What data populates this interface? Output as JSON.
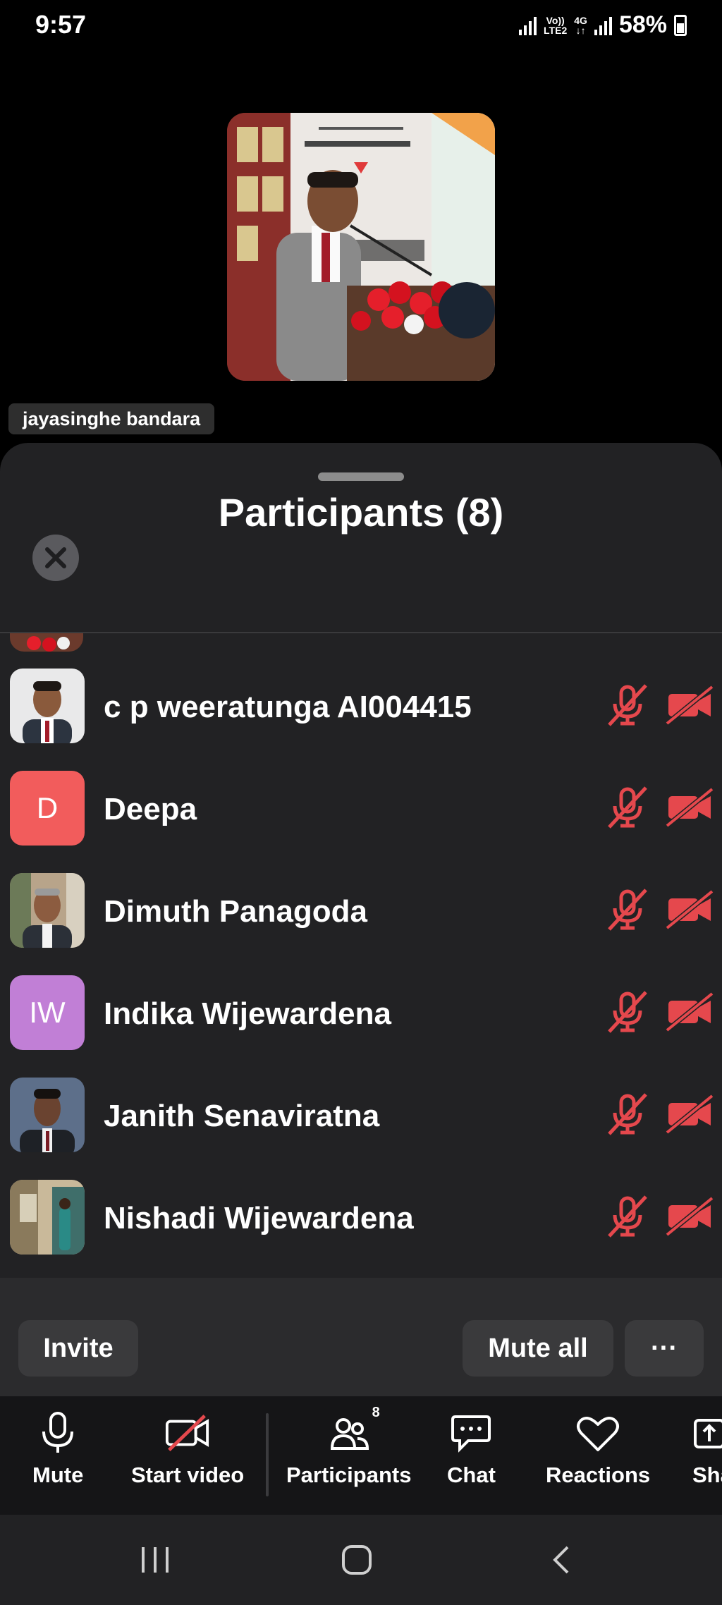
{
  "status_bar": {
    "time": "9:57",
    "network_top": "Vo))",
    "network_bottom": "LTE2",
    "data_top": "4G",
    "data_bottom": "↓↑",
    "battery": "58%"
  },
  "video": {
    "speaker_name": "jayasinghe bandara"
  },
  "participants_panel": {
    "title": "Participants (8)",
    "participants": [
      {
        "name": "c p weeratunga AI004415",
        "initials": "",
        "avatar_type": "photo",
        "mic": "muted",
        "video": "off"
      },
      {
        "name": "Deepa",
        "initials": "D",
        "avatar_type": "initials",
        "avatar_color": "#f25c5c",
        "mic": "muted",
        "video": "off"
      },
      {
        "name": "Dimuth Panagoda",
        "initials": "",
        "avatar_type": "photo",
        "mic": "muted",
        "video": "off"
      },
      {
        "name": "Indika Wijewardena",
        "initials": "IW",
        "avatar_type": "initials",
        "avatar_color": "#c17fd6",
        "mic": "muted",
        "video": "off"
      },
      {
        "name": "Janith Senaviratna",
        "initials": "",
        "avatar_type": "photo",
        "mic": "muted",
        "video": "off"
      },
      {
        "name": "Nishadi Wijewardena",
        "initials": "",
        "avatar_type": "photo",
        "mic": "muted",
        "video": "off"
      }
    ],
    "invite_label": "Invite",
    "mute_all_label": "Mute all",
    "more_label": "···"
  },
  "toolbar": {
    "mute_label": "Mute",
    "start_video_label": "Start video",
    "participants_label": "Participants",
    "participants_count": "8",
    "chat_label": "Chat",
    "reactions_label": "Reactions",
    "share_label": "Sha"
  },
  "colors": {
    "muted_red": "#e5484d",
    "sheet_bg": "#222224",
    "toolbar_bg": "#151517"
  },
  "icons": {
    "close": "close-icon",
    "mic_off": "mic-off-icon",
    "camera_off": "camera-off-icon"
  }
}
